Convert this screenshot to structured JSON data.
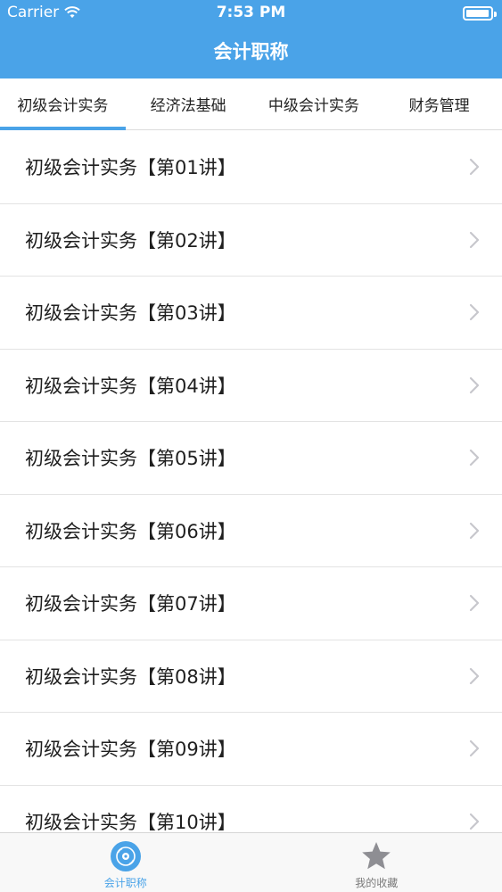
{
  "status_bar": {
    "carrier": "Carrier",
    "time": "7:53 PM",
    "battery_level": 0.95
  },
  "nav": {
    "title": "会计职称"
  },
  "tabs": [
    {
      "label": "初级会计实务",
      "active": true
    },
    {
      "label": "经济法基础",
      "active": false
    },
    {
      "label": "中级会计实务",
      "active": false
    },
    {
      "label": "财务管理",
      "active": false
    }
  ],
  "list": {
    "items": [
      {
        "label": "初级会计实务【第01讲】"
      },
      {
        "label": "初级会计实务【第02讲】"
      },
      {
        "label": "初级会计实务【第03讲】"
      },
      {
        "label": "初级会计实务【第04讲】"
      },
      {
        "label": "初级会计实务【第05讲】"
      },
      {
        "label": "初级会计实务【第06讲】"
      },
      {
        "label": "初级会计实务【第07讲】"
      },
      {
        "label": "初级会计实务【第08讲】"
      },
      {
        "label": "初级会计实务【第09讲】"
      },
      {
        "label": "初级会计实务【第10讲】"
      }
    ]
  },
  "tabbar": {
    "items": [
      {
        "label": "会计职称",
        "icon": "disc-icon",
        "active": true
      },
      {
        "label": "我的收藏",
        "icon": "star-icon",
        "active": false
      }
    ]
  },
  "colors": {
    "accent": "#4aa3e8",
    "chevron": "#c7c7cc",
    "inactive_icon": "#8e8e93"
  }
}
